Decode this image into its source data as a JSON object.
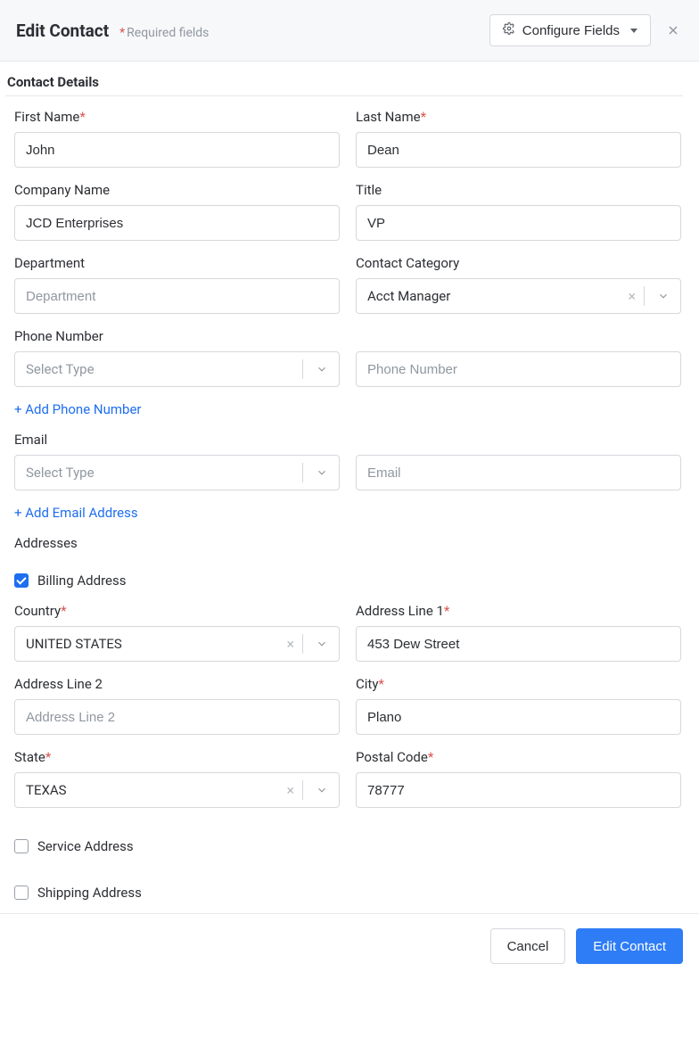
{
  "header": {
    "title": "Edit Contact",
    "required_hint": "Required fields",
    "configure_label": "Configure Fields"
  },
  "section": {
    "title": "Contact Details"
  },
  "labels": {
    "first_name": "First Name",
    "last_name": "Last Name",
    "company_name": "Company Name",
    "title": "Title",
    "department": "Department",
    "contact_category": "Contact Category",
    "phone_number": "Phone Number",
    "email": "Email",
    "addresses": "Addresses",
    "billing_address": "Billing Address",
    "country": "Country",
    "address_line_1": "Address Line 1",
    "address_line_2": "Address Line 2",
    "city": "City",
    "state": "State",
    "postal_code": "Postal Code",
    "service_address": "Service Address",
    "shipping_address": "Shipping Address"
  },
  "values": {
    "first_name": "John",
    "last_name": "Dean",
    "company_name": "JCD Enterprises",
    "title": "VP",
    "department": "",
    "contact_category": "Acct Manager",
    "phone_type": "Select Type",
    "phone_number": "",
    "email_type": "Select Type",
    "email": "",
    "country": "UNITED STATES",
    "address_line_1": "453 Dew Street",
    "address_line_2": "",
    "city": "Plano",
    "state": "TEXAS",
    "postal_code": "78777"
  },
  "placeholders": {
    "department": "Department",
    "phone_number": "Phone Number",
    "email": "Email",
    "address_line_2": "Address Line 2"
  },
  "links": {
    "add_phone": "+ Add Phone Number",
    "add_email": "+ Add Email Address"
  },
  "checkboxes": {
    "billing": true,
    "service": false,
    "shipping": false
  },
  "footer": {
    "cancel": "Cancel",
    "submit": "Edit Contact"
  }
}
